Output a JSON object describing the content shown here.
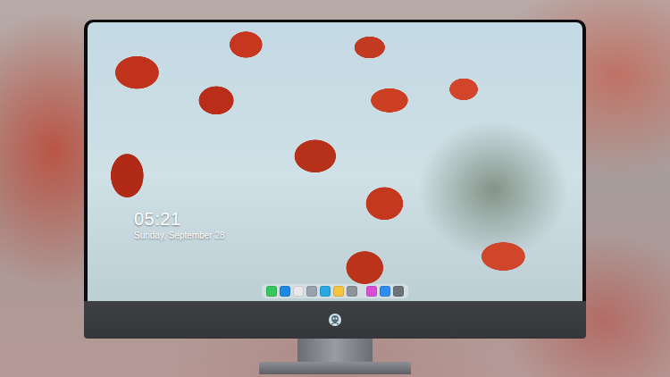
{
  "lock_screen": {
    "time": "05:21",
    "date": "Sunday, September 28"
  },
  "dock": {
    "groups": [
      [
        {
          "color": "#34c759"
        },
        {
          "color": "#1e88e5"
        },
        {
          "color": "#e8e8e8"
        },
        {
          "color": "#9aa3ad"
        },
        {
          "color": "#29a8e0"
        },
        {
          "color": "#f5c542"
        },
        {
          "color": "#8e9499"
        }
      ],
      [
        {
          "color": "#d94fd6"
        },
        {
          "color": "#2f8cf0"
        },
        {
          "color": "#6d7378"
        }
      ]
    ]
  }
}
